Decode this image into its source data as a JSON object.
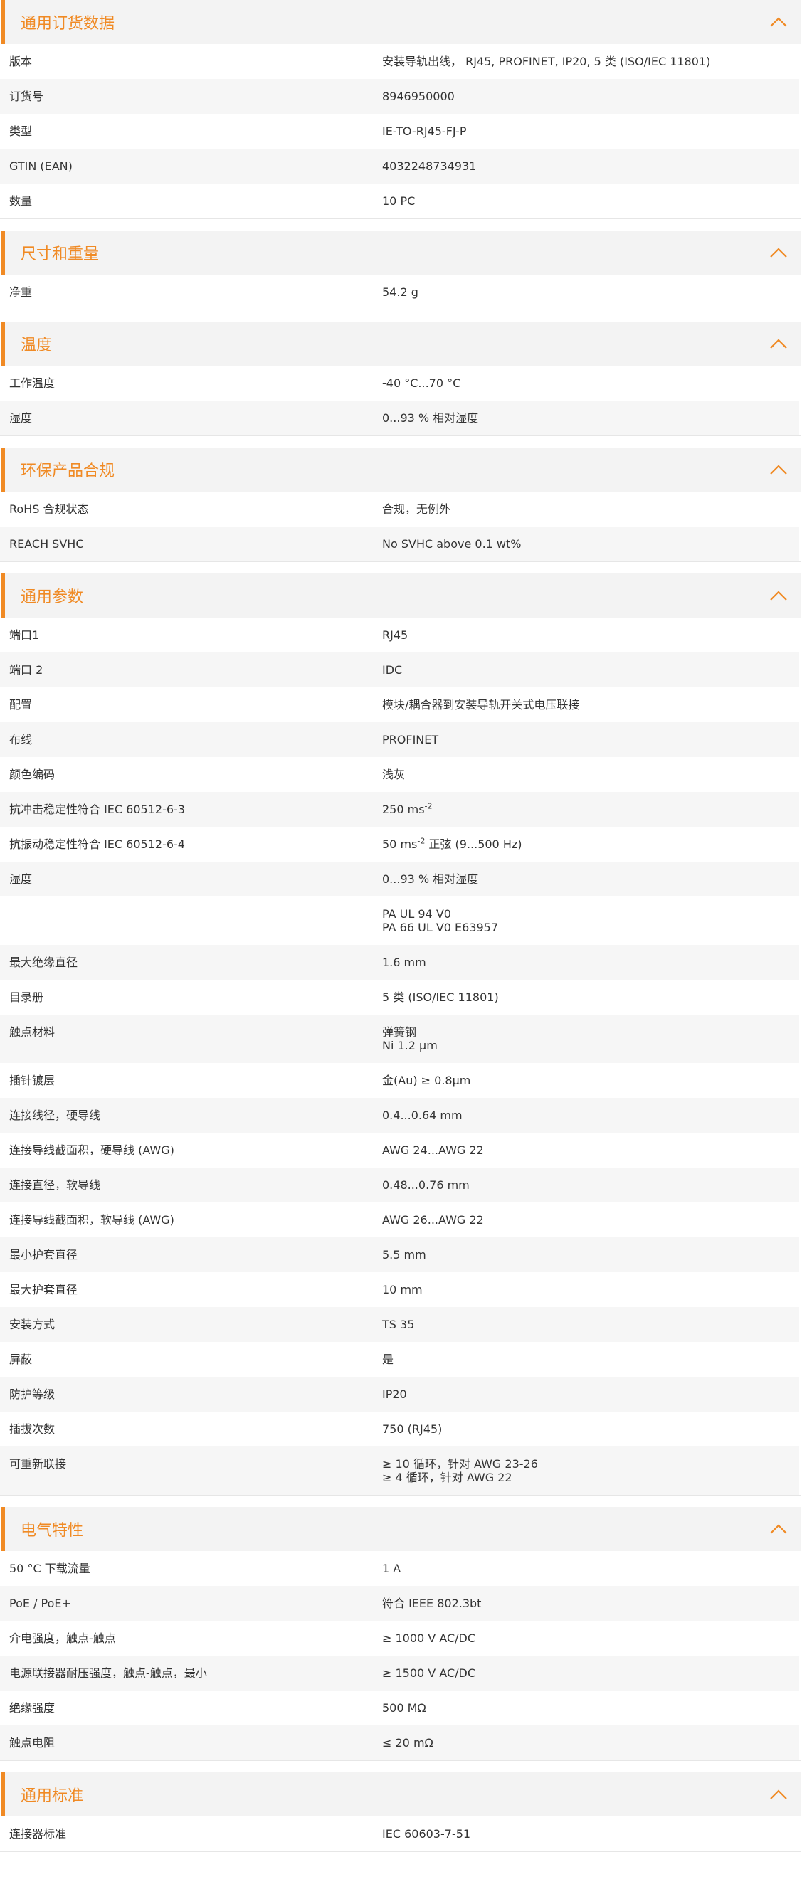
{
  "colors": {
    "accent": "#f08a24",
    "header_bg": "#f3f3f3",
    "row_alt": "#f6f6f6"
  },
  "icons": {
    "toggle": "chevron-up-icon"
  },
  "sections": [
    {
      "title": "通用订货数据",
      "rows": [
        {
          "label": "版本",
          "value": "安装导轨出线， RJ45, PROFINET, IP20, 5 类 (ISO/IEC 11801)"
        },
        {
          "label": "订货号",
          "value": "8946950000"
        },
        {
          "label": "类型",
          "value": "IE-TO-RJ45-FJ-P"
        },
        {
          "label": "GTIN (EAN)",
          "value": "4032248734931"
        },
        {
          "label": "数量",
          "value": "10  PC"
        }
      ]
    },
    {
      "title": "尺寸和重量",
      "rows": [
        {
          "label": "净重",
          "value": "54.2  g"
        }
      ]
    },
    {
      "title": "温度",
      "rows": [
        {
          "label": "工作温度",
          "value": "-40 °C...70 °C"
        },
        {
          "label": "湿度",
          "value": "0...93 % 相对湿度"
        }
      ]
    },
    {
      "title": "环保产品合规",
      "rows": [
        {
          "label": "RoHS 合规状态",
          "value": "合规，无例外"
        },
        {
          "label": "REACH SVHC",
          "value": "No SVHC above 0.1 wt%"
        }
      ]
    },
    {
      "title": "通用参数",
      "rows": [
        {
          "label": "端口1",
          "value": "RJ45"
        },
        {
          "label": "端口 2",
          "value": "IDC"
        },
        {
          "label": "配置",
          "value": "模块/耦合器到安装导轨开关式电压联接"
        },
        {
          "label": "布线",
          "value": "PROFINET"
        },
        {
          "label": "颜色编码",
          "value": "浅灰"
        },
        {
          "label": "抗冲击稳定性符合 IEC 60512-6-3",
          "value": "250 ms",
          "sup": "-2"
        },
        {
          "label": "抗振动稳定性符合 IEC 60512-6-4",
          "value": "50 ms",
          "sup": "-2",
          "value_after": " 正弦 (9...500 Hz)"
        },
        {
          "label": "湿度",
          "value": "0...93 % 相对湿度"
        },
        {
          "label": "",
          "value": "PA UL 94 V0",
          "value2": "PA 66 UL V0 E63957"
        },
        {
          "label": "最大绝缘直径",
          "value": "1.6  mm"
        },
        {
          "label": "目录册",
          "value": "5 类 (ISO/IEC 11801)"
        },
        {
          "label": "触点材料",
          "value": "弹簧钢",
          "value2": "Ni 1.2 µm"
        },
        {
          "label": "插针镀层",
          "value": "金(Au)   ≥ 0.8µm"
        },
        {
          "label": "连接线径，硬导线",
          "value": "0.4...0.64 mm"
        },
        {
          "label": "连接导线截面积，硬导线 (AWG)",
          "value": "AWG 24...AWG 22"
        },
        {
          "label": "连接直径，软导线",
          "value": "0.48...0.76 mm"
        },
        {
          "label": "连接导线截面积，软导线 (AWG)",
          "value": "AWG 26...AWG 22"
        },
        {
          "label": "最小护套直径",
          "value": "5.5  mm"
        },
        {
          "label": "最大护套直径",
          "value": "10  mm"
        },
        {
          "label": "安装方式",
          "value": "TS 35"
        },
        {
          "label": "屏蔽",
          "value": "是"
        },
        {
          "label": "防护等级",
          "value": "IP20"
        },
        {
          "label": "插拔次数",
          "value": "750 (RJ45)"
        },
        {
          "label": "可重新联接",
          "value": "≥ 10 循环，针对 AWG 23-26",
          "value2": "≥ 4 循环，针对 AWG 22"
        }
      ]
    },
    {
      "title": "电气特性",
      "rows": [
        {
          "label": "50 °C 下载流量",
          "value": "1  A"
        },
        {
          "label": "PoE / PoE+",
          "value": "符合 IEEE 802.3bt"
        },
        {
          "label": "介电强度，触点-触点",
          "value": "≥ 1000 V AC/DC"
        },
        {
          "label": "电源联接器耐压强度，触点-触点，最小",
          "value": "≥ 1500 V AC/DC"
        },
        {
          "label": "绝缘强度",
          "value": "500 MΩ"
        },
        {
          "label": "触点电阻",
          "value": "≤ 20 mΩ"
        }
      ]
    },
    {
      "title": "通用标准",
      "rows": [
        {
          "label": "连接器标准",
          "value": "IEC 60603-7-51"
        }
      ]
    }
  ]
}
